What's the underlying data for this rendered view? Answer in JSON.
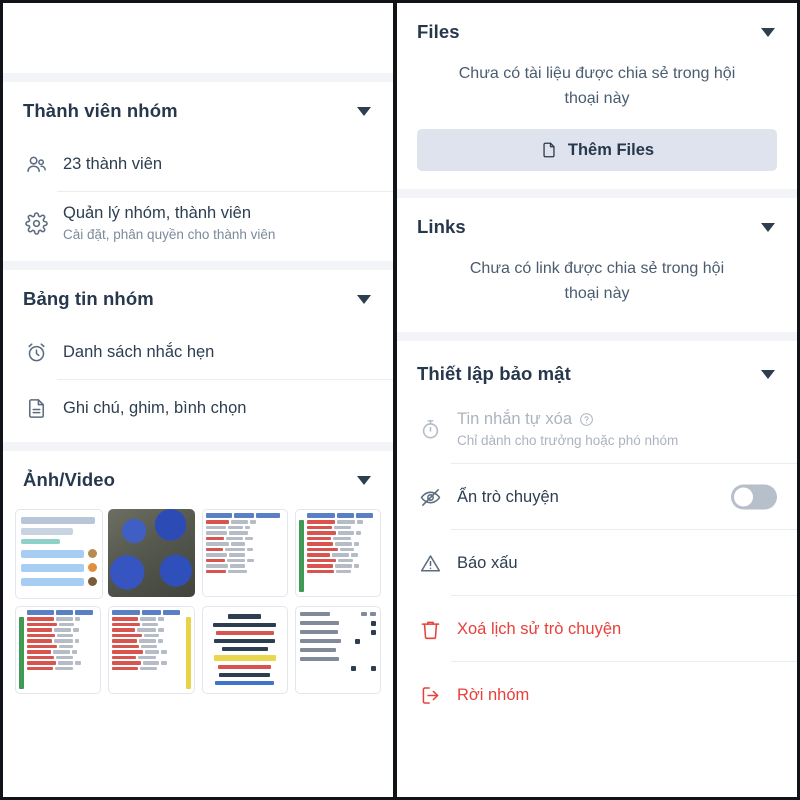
{
  "left_panel": {
    "sections": [
      {
        "id": "members",
        "title": "Thành viên nhóm",
        "caret": "chevron-down-icon",
        "items": [
          {
            "icon": "users-icon",
            "label": "23 thành viên",
            "sub": ""
          },
          {
            "icon": "gear-icon",
            "label": "Quản lý nhóm, thành viên",
            "sub": "Cài đặt, phân quyền cho thành viên"
          }
        ]
      },
      {
        "id": "board",
        "title": "Bảng tin nhóm",
        "caret": "chevron-down-icon",
        "items": [
          {
            "icon": "alarm-clock-icon",
            "label": "Danh sách nhắc hẹn",
            "sub": ""
          },
          {
            "icon": "note-icon",
            "label": "Ghi chú, ghim, bình chọn",
            "sub": ""
          }
        ]
      },
      {
        "id": "media",
        "title": "Ảnh/Video",
        "caret": "chevron-down-icon",
        "thumbnails": [
          {
            "kind": "chat-screenshot",
            "alt": "Ảnh chụp màn hình hội thoại bình chọn"
          },
          {
            "kind": "photo",
            "alt": "Ảnh bao tải màu xanh"
          },
          {
            "kind": "spreadsheet",
            "alt": "Ảnh bảng tính"
          },
          {
            "kind": "spreadsheet-green",
            "alt": "Ảnh bảng tính có cột xanh"
          },
          {
            "kind": "spreadsheet-green",
            "alt": "Ảnh bảng tính có cột xanh"
          },
          {
            "kind": "spreadsheet-yellow",
            "alt": "Ảnh bảng tính có cột vàng"
          },
          {
            "kind": "note",
            "alt": "Ảnh ghi chú chào các bạn"
          },
          {
            "kind": "id-table",
            "alt": "Ảnh bảng số điện thoại"
          }
        ]
      }
    ]
  },
  "right_panel": {
    "sections": [
      {
        "id": "files",
        "title": "Files",
        "caret": "chevron-down-icon",
        "empty_text": "Chưa có tài liệu được chia sẻ trong hội thoại này",
        "button": {
          "icon": "file-icon",
          "label": "Thêm Files"
        }
      },
      {
        "id": "links",
        "title": "Links",
        "caret": "chevron-down-icon",
        "empty_text": "Chưa có link được chia sẻ trong hội thoại này"
      },
      {
        "id": "security",
        "title": "Thiết lập bảo mật",
        "caret": "chevron-down-icon",
        "items": [
          {
            "icon": "timer-icon",
            "label": "Tin nhắn tự xóa",
            "help_icon": "question-circle-icon",
            "sub": "Chỉ dành cho trưởng hoặc phó nhóm",
            "state": "disabled"
          },
          {
            "icon": "eye-off-icon",
            "label": "Ẩn trò chuyện",
            "sub": "",
            "state": "normal",
            "toggle": {
              "name": "hide-conversation-toggle",
              "on": false
            }
          },
          {
            "icon": "warning-triangle-icon",
            "label": "Báo xấu",
            "sub": "",
            "state": "normal"
          },
          {
            "icon": "trash-icon",
            "label": "Xoá lịch sử trò chuyện",
            "sub": "",
            "state": "danger"
          },
          {
            "icon": "exit-icon",
            "label": "Rời nhóm",
            "sub": "",
            "state": "danger"
          }
        ]
      }
    ]
  },
  "colors": {
    "text_primary": "#2c3e50",
    "text_heading": "#27384d",
    "text_muted": "#7c8a9c",
    "text_disabled": "#aab3bf",
    "danger": "#e8403a",
    "button_bg": "#dfe3ed",
    "section_gap": "#f3f4f7",
    "divider": "#e9ecf1",
    "toggle_off": "#b7bfca"
  }
}
